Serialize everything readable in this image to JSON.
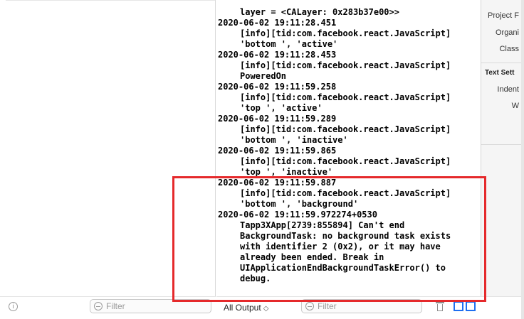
{
  "console": {
    "log": [
      {
        "timestamp": "",
        "lines": [
          "layer = <CALayer: 0x283b37e00>>"
        ]
      },
      {
        "timestamp": "2020-06-02 19:11:28.451",
        "lines": [
          "[info][tid:com.facebook.react.JavaScript]",
          "'bottom ', 'active'"
        ]
      },
      {
        "timestamp": "2020-06-02 19:11:28.453",
        "lines": [
          "[info][tid:com.facebook.react.JavaScript]",
          "PoweredOn"
        ]
      },
      {
        "timestamp": "2020-06-02 19:11:59.258",
        "lines": [
          "[info][tid:com.facebook.react.JavaScript]",
          "'top ', 'active'"
        ]
      },
      {
        "timestamp": "2020-06-02 19:11:59.289",
        "lines": [
          "[info][tid:com.facebook.react.JavaScript]",
          "'bottom ', 'inactive'"
        ]
      },
      {
        "timestamp": "2020-06-02 19:11:59.865",
        "lines": [
          "[info][tid:com.facebook.react.JavaScript]",
          "'top ', 'inactive'"
        ]
      },
      {
        "timestamp": "2020-06-02 19:11:59.887",
        "lines": [
          "[info][tid:com.facebook.react.JavaScript]",
          "'bottom ', 'background'"
        ]
      },
      {
        "timestamp": "2020-06-02 19:11:59.972274+0530",
        "lines": [
          "Tapp3XApp[2739:855894] Can't end",
          "BackgroundTask: no background task exists",
          "with identifier 2 (0x2), or it may have",
          "already been ended. Break in",
          "UIApplicationEndBackgroundTaskError() to",
          "debug."
        ]
      }
    ]
  },
  "inspector": {
    "rows": [
      "Project F",
      "Organi",
      "Class"
    ],
    "section_title": "Text Sett",
    "section_rows": [
      "Indent",
      "W"
    ]
  },
  "footer": {
    "variables_filter_placeholder": "Filter",
    "output_select_label": "All Output",
    "output_select_chevron": "◇",
    "console_filter_placeholder": "Filter",
    "info_icon_glyph": "i"
  },
  "colors": {
    "highlight_border": "#e5292b",
    "split_button_accent": "#1e6ff0"
  }
}
